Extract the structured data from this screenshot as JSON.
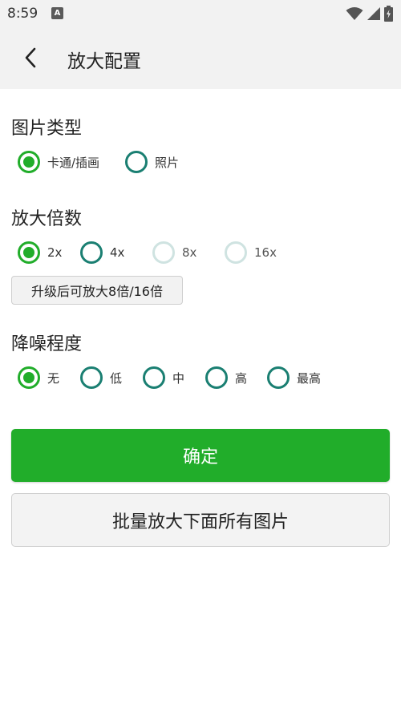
{
  "status_bar": {
    "time": "8:59",
    "notification_glyph": "A",
    "icons": [
      "wifi-icon",
      "signal-icon",
      "battery-icon"
    ]
  },
  "app_bar": {
    "title": "放大配置",
    "back_icon": "back-arrow-icon"
  },
  "image_type": {
    "title": "图片类型",
    "options": [
      {
        "label": "卡通/插画",
        "checked": true
      },
      {
        "label": "照片",
        "checked": false
      }
    ]
  },
  "scale": {
    "title": "放大倍数",
    "options": [
      {
        "label": "2x",
        "checked": true,
        "enabled": true
      },
      {
        "label": "4x",
        "checked": false,
        "enabled": true
      },
      {
        "label": "8x",
        "checked": false,
        "enabled": false
      },
      {
        "label": "16x",
        "checked": false,
        "enabled": false
      }
    ],
    "upgrade_label": "升级后可放大8倍/16倍"
  },
  "denoise": {
    "title": "降噪程度",
    "options": [
      {
        "label": "无",
        "checked": true
      },
      {
        "label": "低",
        "checked": false
      },
      {
        "label": "中",
        "checked": false
      },
      {
        "label": "高",
        "checked": false
      },
      {
        "label": "最高",
        "checked": false
      }
    ]
  },
  "actions": {
    "confirm_label": "确定",
    "batch_label": "批量放大下面所有图片"
  },
  "colors": {
    "accent": "#21ad2a",
    "radio_ring": "#1a7f72",
    "disabled_ring": "#cfe3e1"
  }
}
